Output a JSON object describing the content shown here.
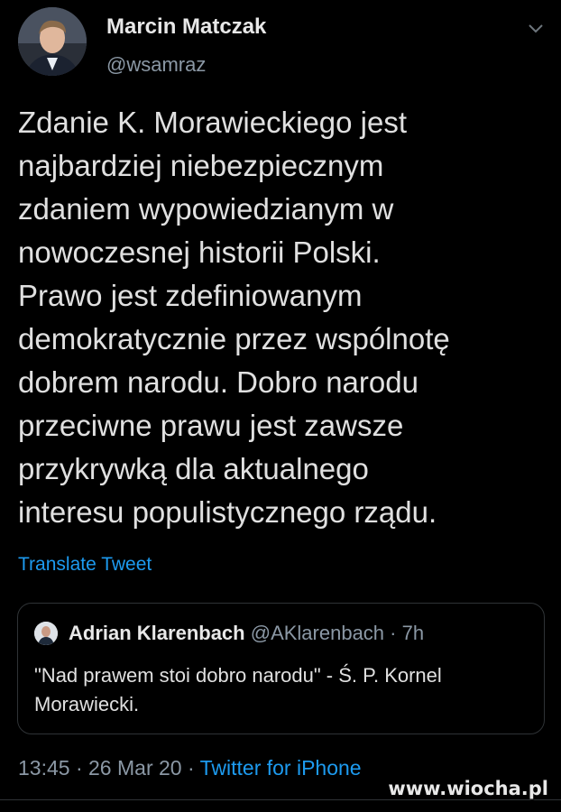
{
  "tweet": {
    "author": {
      "display_name": "Marcin Matczak",
      "handle": "@wsamraz"
    },
    "text": "Zdanie K. Morawieckiego jest\nnajbardziej niebezpiecznym\nzdaniem wypowiedzianym w\nnowoczesnej historii Polski.\nPrawo jest zdefiniowanym\ndemokratycznie przez wspólnotę\ndobrem narodu. Dobro narodu\nprzeciwne prawu jest zawsze\nprzykrywką dla aktualnego\ninteresu populistycznego rządu.",
    "translate_label": "Translate Tweet",
    "menu_icon": "chevron-down-icon"
  },
  "quote": {
    "display_name": "Adrian Klarenbach",
    "handle": "@AKlarenbach",
    "separator": "·",
    "time": "7h",
    "text": "\"Nad prawem stoi dobro narodu\" - Ś. P. Kornel\nMorawiecki."
  },
  "meta": {
    "time": "13:45",
    "separator": "·",
    "date": "26 Mar 20",
    "source": "Twitter for iPhone"
  },
  "watermark": "www.wiocha.pl",
  "colors": {
    "background": "#000000",
    "link": "#1d9bf0",
    "muted": "#8b98a5",
    "border": "#2f3336"
  }
}
